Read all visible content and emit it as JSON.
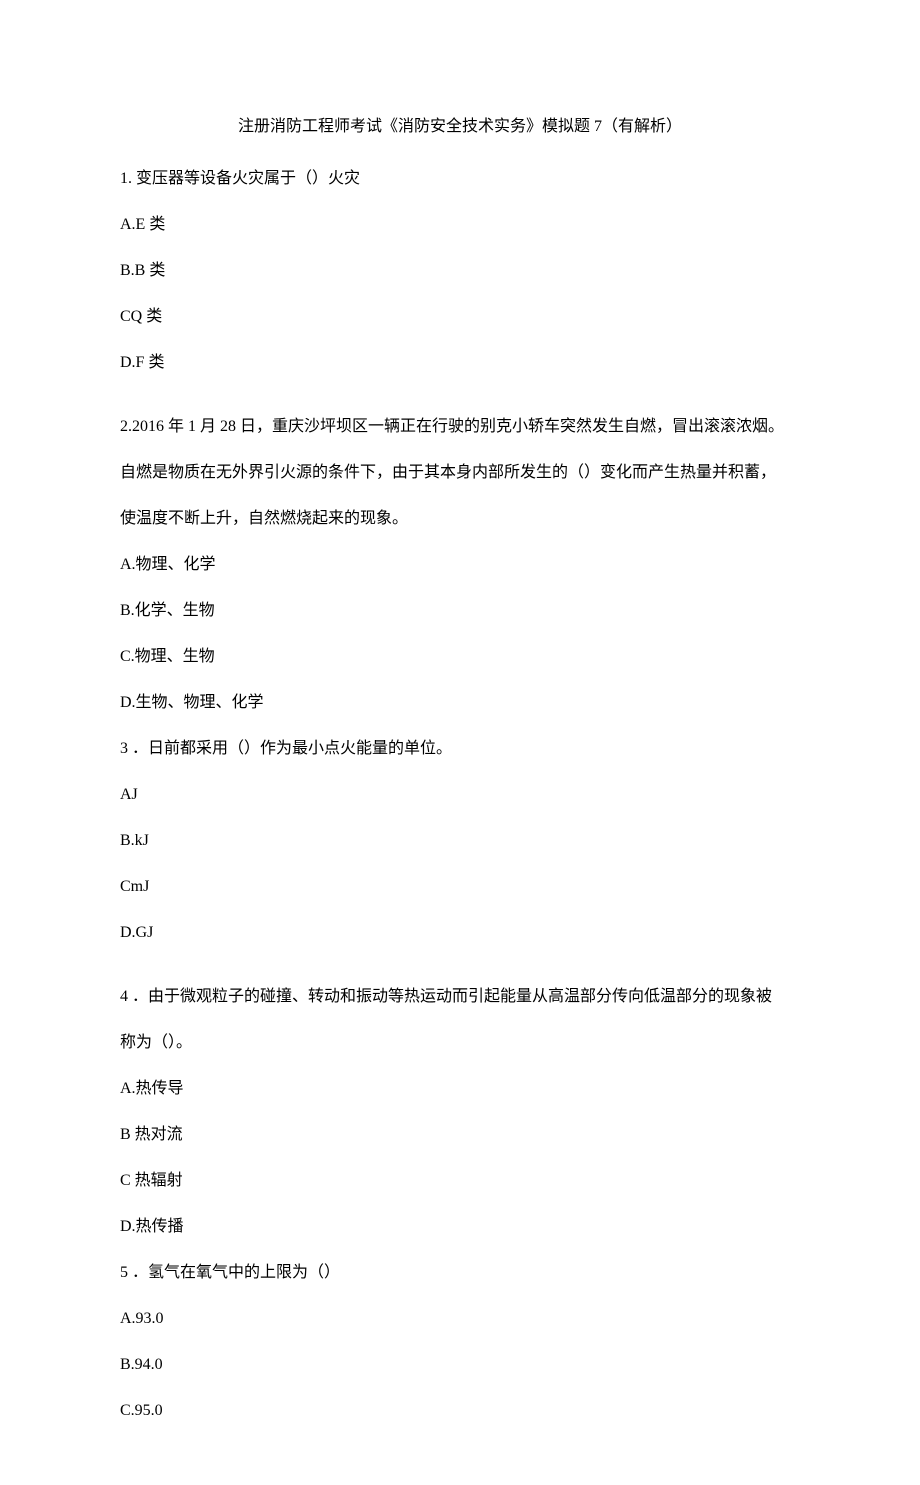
{
  "title": "注册消防工程师考试《消防安全技术实务》模拟题 7（有解析）",
  "q1": {
    "stem": "1. 变压器等设备火灾属于（）火灾",
    "a": "A.E 类",
    "b": "B.B 类",
    "c": "CQ 类",
    "d": "D.F 类"
  },
  "q2": {
    "l1": "2.2016 年 1 月 28 日，重庆沙坪坝区一辆正在行驶的别克小轿车突然发生自燃，冒出滚滚浓烟。",
    "l2": "自燃是物质在无外界引火源的条件下，由于其本身内部所发生的（）变化而产生热量并积蓄，",
    "l3": "使温度不断上升，自然燃烧起来的现象。",
    "a": "A.物理、化学",
    "b": "B.化学、生物",
    "c": "C.物理、生物",
    "d": "D.生物、物理、化学"
  },
  "q3": {
    "stem": "3 ．日前都采用（）作为最小点火能量的单位。",
    "a": "AJ",
    "b": "B.kJ",
    "c": "CmJ",
    "d": "D.GJ"
  },
  "q4": {
    "l1": "4 ．由于微观粒子的碰撞、转动和振动等热运动而引起能量从高温部分传向低温部分的现象被",
    "l2": "称为（）。",
    "a": "A.热传导",
    "b": "B 热对流",
    "c": "C 热辐射",
    "d": "D.热传播"
  },
  "q5": {
    "stem": "5 ．氢气在氧气中的上限为（）",
    "a": "A.93.0",
    "b": "B.94.0",
    "c": "C.95.0"
  }
}
